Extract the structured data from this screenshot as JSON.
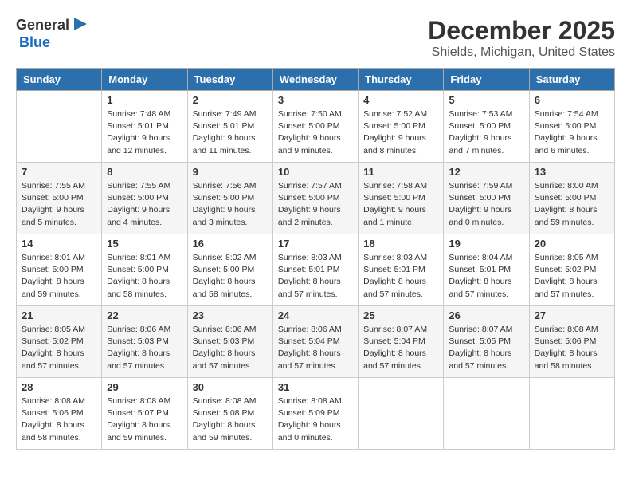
{
  "logo": {
    "text_general": "General",
    "text_blue": "Blue"
  },
  "title": "December 2025",
  "location": "Shields, Michigan, United States",
  "days_of_week": [
    "Sunday",
    "Monday",
    "Tuesday",
    "Wednesday",
    "Thursday",
    "Friday",
    "Saturday"
  ],
  "weeks": [
    [
      {
        "day": "",
        "content": ""
      },
      {
        "day": "1",
        "content": "Sunrise: 7:48 AM\nSunset: 5:01 PM\nDaylight: 9 hours\nand 12 minutes."
      },
      {
        "day": "2",
        "content": "Sunrise: 7:49 AM\nSunset: 5:01 PM\nDaylight: 9 hours\nand 11 minutes."
      },
      {
        "day": "3",
        "content": "Sunrise: 7:50 AM\nSunset: 5:00 PM\nDaylight: 9 hours\nand 9 minutes."
      },
      {
        "day": "4",
        "content": "Sunrise: 7:52 AM\nSunset: 5:00 PM\nDaylight: 9 hours\nand 8 minutes."
      },
      {
        "day": "5",
        "content": "Sunrise: 7:53 AM\nSunset: 5:00 PM\nDaylight: 9 hours\nand 7 minutes."
      },
      {
        "day": "6",
        "content": "Sunrise: 7:54 AM\nSunset: 5:00 PM\nDaylight: 9 hours\nand 6 minutes."
      }
    ],
    [
      {
        "day": "7",
        "content": "Sunrise: 7:55 AM\nSunset: 5:00 PM\nDaylight: 9 hours\nand 5 minutes."
      },
      {
        "day": "8",
        "content": "Sunrise: 7:55 AM\nSunset: 5:00 PM\nDaylight: 9 hours\nand 4 minutes."
      },
      {
        "day": "9",
        "content": "Sunrise: 7:56 AM\nSunset: 5:00 PM\nDaylight: 9 hours\nand 3 minutes."
      },
      {
        "day": "10",
        "content": "Sunrise: 7:57 AM\nSunset: 5:00 PM\nDaylight: 9 hours\nand 2 minutes."
      },
      {
        "day": "11",
        "content": "Sunrise: 7:58 AM\nSunset: 5:00 PM\nDaylight: 9 hours\nand 1 minute."
      },
      {
        "day": "12",
        "content": "Sunrise: 7:59 AM\nSunset: 5:00 PM\nDaylight: 9 hours\nand 0 minutes."
      },
      {
        "day": "13",
        "content": "Sunrise: 8:00 AM\nSunset: 5:00 PM\nDaylight: 8 hours\nand 59 minutes."
      }
    ],
    [
      {
        "day": "14",
        "content": "Sunrise: 8:01 AM\nSunset: 5:00 PM\nDaylight: 8 hours\nand 59 minutes."
      },
      {
        "day": "15",
        "content": "Sunrise: 8:01 AM\nSunset: 5:00 PM\nDaylight: 8 hours\nand 58 minutes."
      },
      {
        "day": "16",
        "content": "Sunrise: 8:02 AM\nSunset: 5:00 PM\nDaylight: 8 hours\nand 58 minutes."
      },
      {
        "day": "17",
        "content": "Sunrise: 8:03 AM\nSunset: 5:01 PM\nDaylight: 8 hours\nand 57 minutes."
      },
      {
        "day": "18",
        "content": "Sunrise: 8:03 AM\nSunset: 5:01 PM\nDaylight: 8 hours\nand 57 minutes."
      },
      {
        "day": "19",
        "content": "Sunrise: 8:04 AM\nSunset: 5:01 PM\nDaylight: 8 hours\nand 57 minutes."
      },
      {
        "day": "20",
        "content": "Sunrise: 8:05 AM\nSunset: 5:02 PM\nDaylight: 8 hours\nand 57 minutes."
      }
    ],
    [
      {
        "day": "21",
        "content": "Sunrise: 8:05 AM\nSunset: 5:02 PM\nDaylight: 8 hours\nand 57 minutes."
      },
      {
        "day": "22",
        "content": "Sunrise: 8:06 AM\nSunset: 5:03 PM\nDaylight: 8 hours\nand 57 minutes."
      },
      {
        "day": "23",
        "content": "Sunrise: 8:06 AM\nSunset: 5:03 PM\nDaylight: 8 hours\nand 57 minutes."
      },
      {
        "day": "24",
        "content": "Sunrise: 8:06 AM\nSunset: 5:04 PM\nDaylight: 8 hours\nand 57 minutes."
      },
      {
        "day": "25",
        "content": "Sunrise: 8:07 AM\nSunset: 5:04 PM\nDaylight: 8 hours\nand 57 minutes."
      },
      {
        "day": "26",
        "content": "Sunrise: 8:07 AM\nSunset: 5:05 PM\nDaylight: 8 hours\nand 57 minutes."
      },
      {
        "day": "27",
        "content": "Sunrise: 8:08 AM\nSunset: 5:06 PM\nDaylight: 8 hours\nand 58 minutes."
      }
    ],
    [
      {
        "day": "28",
        "content": "Sunrise: 8:08 AM\nSunset: 5:06 PM\nDaylight: 8 hours\nand 58 minutes."
      },
      {
        "day": "29",
        "content": "Sunrise: 8:08 AM\nSunset: 5:07 PM\nDaylight: 8 hours\nand 59 minutes."
      },
      {
        "day": "30",
        "content": "Sunrise: 8:08 AM\nSunset: 5:08 PM\nDaylight: 8 hours\nand 59 minutes."
      },
      {
        "day": "31",
        "content": "Sunrise: 8:08 AM\nSunset: 5:09 PM\nDaylight: 9 hours\nand 0 minutes."
      },
      {
        "day": "",
        "content": ""
      },
      {
        "day": "",
        "content": ""
      },
      {
        "day": "",
        "content": ""
      }
    ]
  ]
}
